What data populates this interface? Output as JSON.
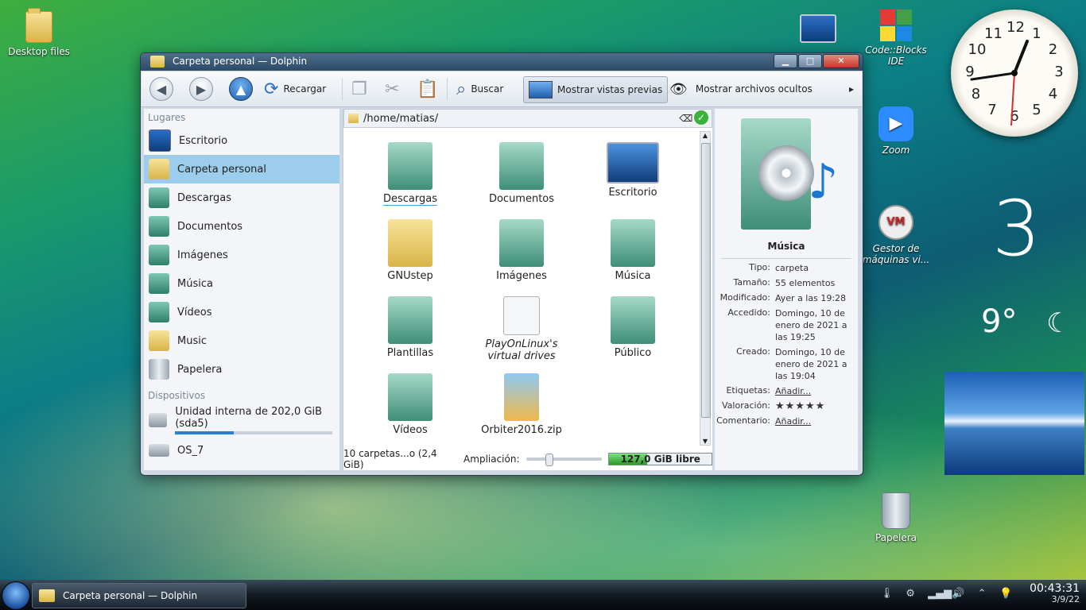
{
  "desktop": {
    "icons": [
      {
        "label": "Desktop files"
      },
      {
        "label": "Code::Blocks IDE"
      },
      {
        "label": "Zoom"
      },
      {
        "label": "Gestor de máquinas vi..."
      },
      {
        "label": "Papelera"
      }
    ]
  },
  "window": {
    "title": "Carpeta personal — Dolphin",
    "controls": {
      "minimize": "▁",
      "maximize": "□",
      "close": "✕"
    }
  },
  "toolbar": {
    "reload": "Recargar",
    "search": "Buscar",
    "preview": "Mostrar vistas previas",
    "hidden": "Mostrar archivos ocultos",
    "more": "▸"
  },
  "sidebar": {
    "places_heading": "Lugares",
    "places": [
      {
        "label": "Escritorio"
      },
      {
        "label": "Carpeta personal"
      },
      {
        "label": "Descargas"
      },
      {
        "label": "Documentos"
      },
      {
        "label": "Imágenes"
      },
      {
        "label": "Música"
      },
      {
        "label": "Vídeos"
      },
      {
        "label": "Music"
      },
      {
        "label": "Papelera"
      }
    ],
    "devices_heading": "Dispositivos",
    "devices": [
      {
        "label": "Unidad interna de 202,0 GiB (sda5)",
        "usage": 0.37
      },
      {
        "label": "OS_7"
      }
    ]
  },
  "main": {
    "path": "/home/matias/",
    "items": [
      {
        "label": "Descargas"
      },
      {
        "label": "Documentos"
      },
      {
        "label": "Escritorio"
      },
      {
        "label": "GNUstep"
      },
      {
        "label": "Imágenes"
      },
      {
        "label": "Música"
      },
      {
        "label": "Plantillas"
      },
      {
        "label": "PlayOnLinux's virtual drives",
        "italic": true
      },
      {
        "label": "Público"
      },
      {
        "label": "Vídeos"
      },
      {
        "label": "Orbiter2016.zip"
      }
    ],
    "status": "10 carpetas...o (2,4 GiB)",
    "zoom_label": "Ampliación:",
    "disk_free": "127,0 GiB libre",
    "disk_used_fraction": 0.37
  },
  "info": {
    "title": "Música",
    "rows": [
      {
        "key": "Tipo:",
        "value": "carpeta"
      },
      {
        "key": "Tamaño:",
        "value": "55 elementos"
      },
      {
        "key": "Modificado:",
        "value": "Ayer a las 19:28"
      },
      {
        "key": "Accedido:",
        "value": "Domingo, 10 de enero de 2021 a las 19:25"
      },
      {
        "key": "Creado:",
        "value": "Domingo, 10 de enero de 2021 a las 19:04"
      }
    ],
    "tags_key": "Etiquetas:",
    "tags_value": "Añadir...",
    "rating_key": "Valoración:",
    "rating_stars": "★★★★★",
    "comment_key": "Comentario:",
    "comment_value": "Añadir..."
  },
  "gadgets": {
    "clock_numbers": [
      "12",
      "1",
      "2",
      "3",
      "4",
      "5",
      "6",
      "7",
      "8",
      "9",
      "10",
      "11"
    ],
    "big_number": "3",
    "temperature": "9°"
  },
  "taskbar": {
    "task_label": "Carpeta personal — Dolphin",
    "time": "00:43:31",
    "date": "3/9/22"
  }
}
